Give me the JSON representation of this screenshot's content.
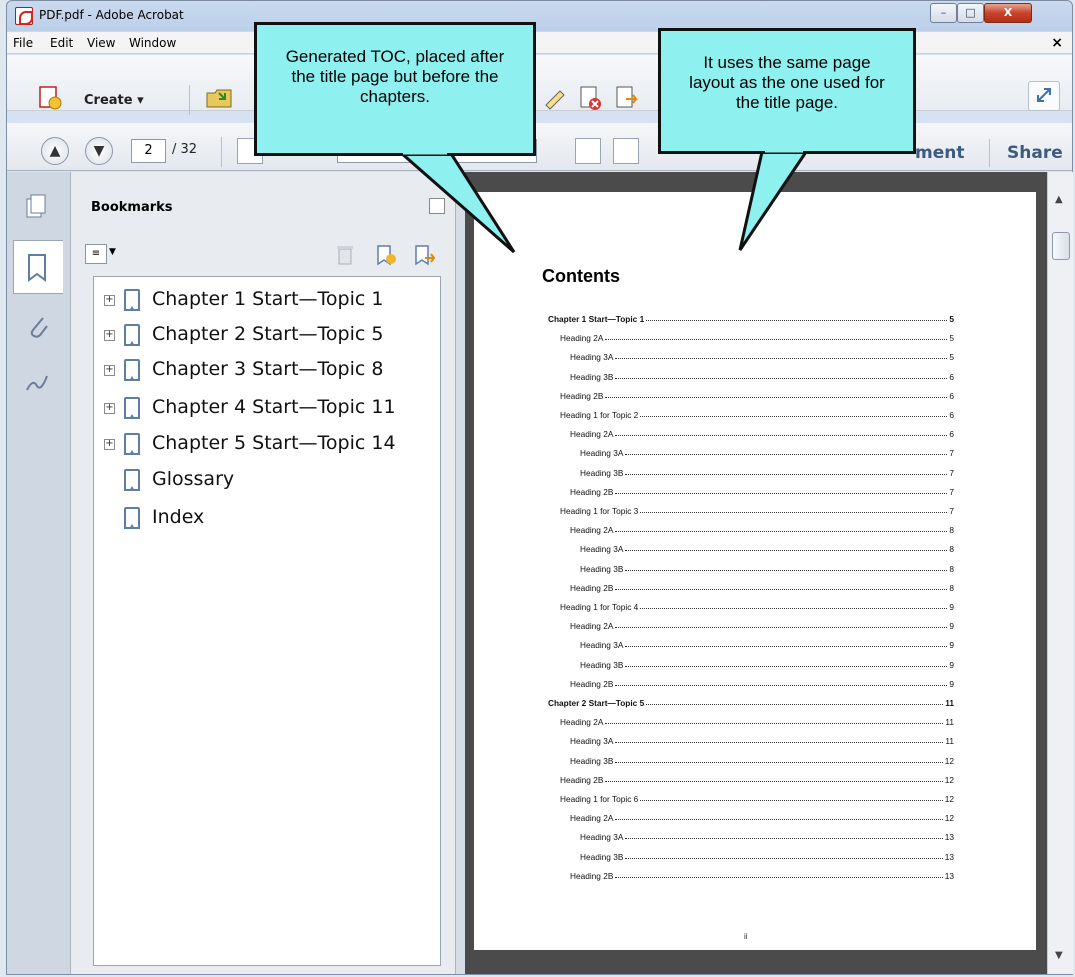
{
  "window": {
    "title": "PDF.pdf - Adobe Acrobat",
    "controls": [
      "–",
      "□",
      "X"
    ]
  },
  "menubar": {
    "items": [
      "File",
      "Edit",
      "View",
      "Window"
    ],
    "close": "×"
  },
  "toolbar": {
    "create_label": "Create ▾"
  },
  "navigation": {
    "current_page": "2",
    "total_pages": "/ 32",
    "comment_label": "ment",
    "share_label": "Share"
  },
  "bookmarks_panel": {
    "title": "Bookmarks",
    "items": [
      {
        "label": "Chapter 1 Start—Topic 1",
        "expandable": true
      },
      {
        "label": "Chapter 2 Start—Topic 5",
        "expandable": true
      },
      {
        "label": "Chapter 3 Start—Topic 8",
        "expandable": true
      },
      {
        "label": "Chapter 4 Start—Topic 11",
        "expandable": true
      },
      {
        "label": "Chapter 5 Start—Topic 14",
        "expandable": true
      },
      {
        "label": "Glossary",
        "expandable": false
      },
      {
        "label": "Index",
        "expandable": false
      }
    ]
  },
  "document": {
    "toc_title": "Contents",
    "entries": [
      {
        "text": "Chapter 1 Start—Topic 1",
        "page": "5",
        "level": 0,
        "bold": true
      },
      {
        "text": "Heading 2A",
        "page": "5",
        "level": 1
      },
      {
        "text": "Heading 3A",
        "page": "5",
        "level": 2
      },
      {
        "text": "Heading 3B",
        "page": "6",
        "level": 2
      },
      {
        "text": "Heading 2B",
        "page": "6",
        "level": 1
      },
      {
        "text": "Heading 1 for Topic 2",
        "page": "6",
        "level": 1
      },
      {
        "text": "Heading 2A",
        "page": "6",
        "level": 2
      },
      {
        "text": "Heading 3A",
        "page": "7",
        "level": 3
      },
      {
        "text": "Heading 3B",
        "page": "7",
        "level": 3
      },
      {
        "text": "Heading 2B",
        "page": "7",
        "level": 2
      },
      {
        "text": "Heading 1 for Topic 3",
        "page": "7",
        "level": 1
      },
      {
        "text": "Heading 2A",
        "page": "8",
        "level": 2
      },
      {
        "text": "Heading 3A",
        "page": "8",
        "level": 3
      },
      {
        "text": "Heading 3B",
        "page": "8",
        "level": 3
      },
      {
        "text": "Heading 2B",
        "page": "8",
        "level": 2
      },
      {
        "text": "Heading 1 for Topic 4",
        "page": "9",
        "level": 1
      },
      {
        "text": "Heading 2A",
        "page": "9",
        "level": 2
      },
      {
        "text": "Heading 3A",
        "page": "9",
        "level": 3
      },
      {
        "text": "Heading 3B",
        "page": "9",
        "level": 3
      },
      {
        "text": "Heading 2B",
        "page": "9",
        "level": 2
      },
      {
        "text": "Chapter 2 Start—Topic 5",
        "page": "11",
        "level": 0,
        "bold": true
      },
      {
        "text": "Heading 2A",
        "page": "11",
        "level": 1
      },
      {
        "text": "Heading 3A",
        "page": "11",
        "level": 2
      },
      {
        "text": "Heading 3B",
        "page": "12",
        "level": 2
      },
      {
        "text": "Heading 2B",
        "page": "12",
        "level": 1
      },
      {
        "text": "Heading 1 for Topic 6",
        "page": "12",
        "level": 1
      },
      {
        "text": "Heading 2A",
        "page": "12",
        "level": 2
      },
      {
        "text": "Heading 3A",
        "page": "13",
        "level": 3
      },
      {
        "text": "Heading 3B",
        "page": "13",
        "level": 3
      },
      {
        "text": "Heading 2B",
        "page": "13",
        "level": 2
      }
    ],
    "footer": "ii"
  },
  "callouts": [
    {
      "text": "Generated TOC, placed after the title page but before the chapters."
    },
    {
      "text": "It uses the same page layout as the one used for the title page."
    }
  ],
  "colors": {
    "callout_fill": "#8ef0ef",
    "doc_background": "#4b4b4b",
    "accent_text": "#3d5a82"
  }
}
